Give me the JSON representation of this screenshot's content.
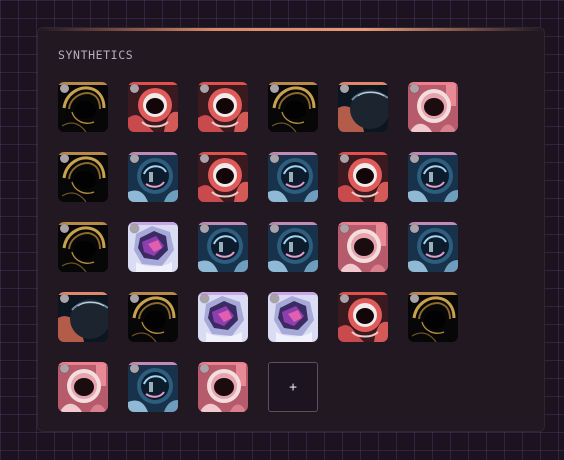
{
  "panel": {
    "title": "SYNTHETICS",
    "add_label": "+"
  },
  "thumbnails": [
    {
      "variant": "gold-helmet"
    },
    {
      "variant": "red-suit"
    },
    {
      "variant": "red-suit"
    },
    {
      "variant": "gold-helmet"
    },
    {
      "variant": "dark-planet"
    },
    {
      "variant": "pink-suit"
    },
    {
      "variant": "gold-helmet"
    },
    {
      "variant": "blue-visor"
    },
    {
      "variant": "red-suit"
    },
    {
      "variant": "blue-visor"
    },
    {
      "variant": "red-suit"
    },
    {
      "variant": "blue-visor"
    },
    {
      "variant": "gold-helmet"
    },
    {
      "variant": "crystal-helmet"
    },
    {
      "variant": "blue-visor"
    },
    {
      "variant": "blue-visor"
    },
    {
      "variant": "pink-suit"
    },
    {
      "variant": "blue-visor"
    },
    {
      "variant": "dark-planet"
    },
    {
      "variant": "gold-helmet"
    },
    {
      "variant": "crystal-helmet"
    },
    {
      "variant": "crystal-helmet"
    },
    {
      "variant": "red-suit"
    },
    {
      "variant": "gold-helmet"
    },
    {
      "variant": "pink-suit"
    },
    {
      "variant": "blue-visor"
    },
    {
      "variant": "pink-suit"
    }
  ]
}
